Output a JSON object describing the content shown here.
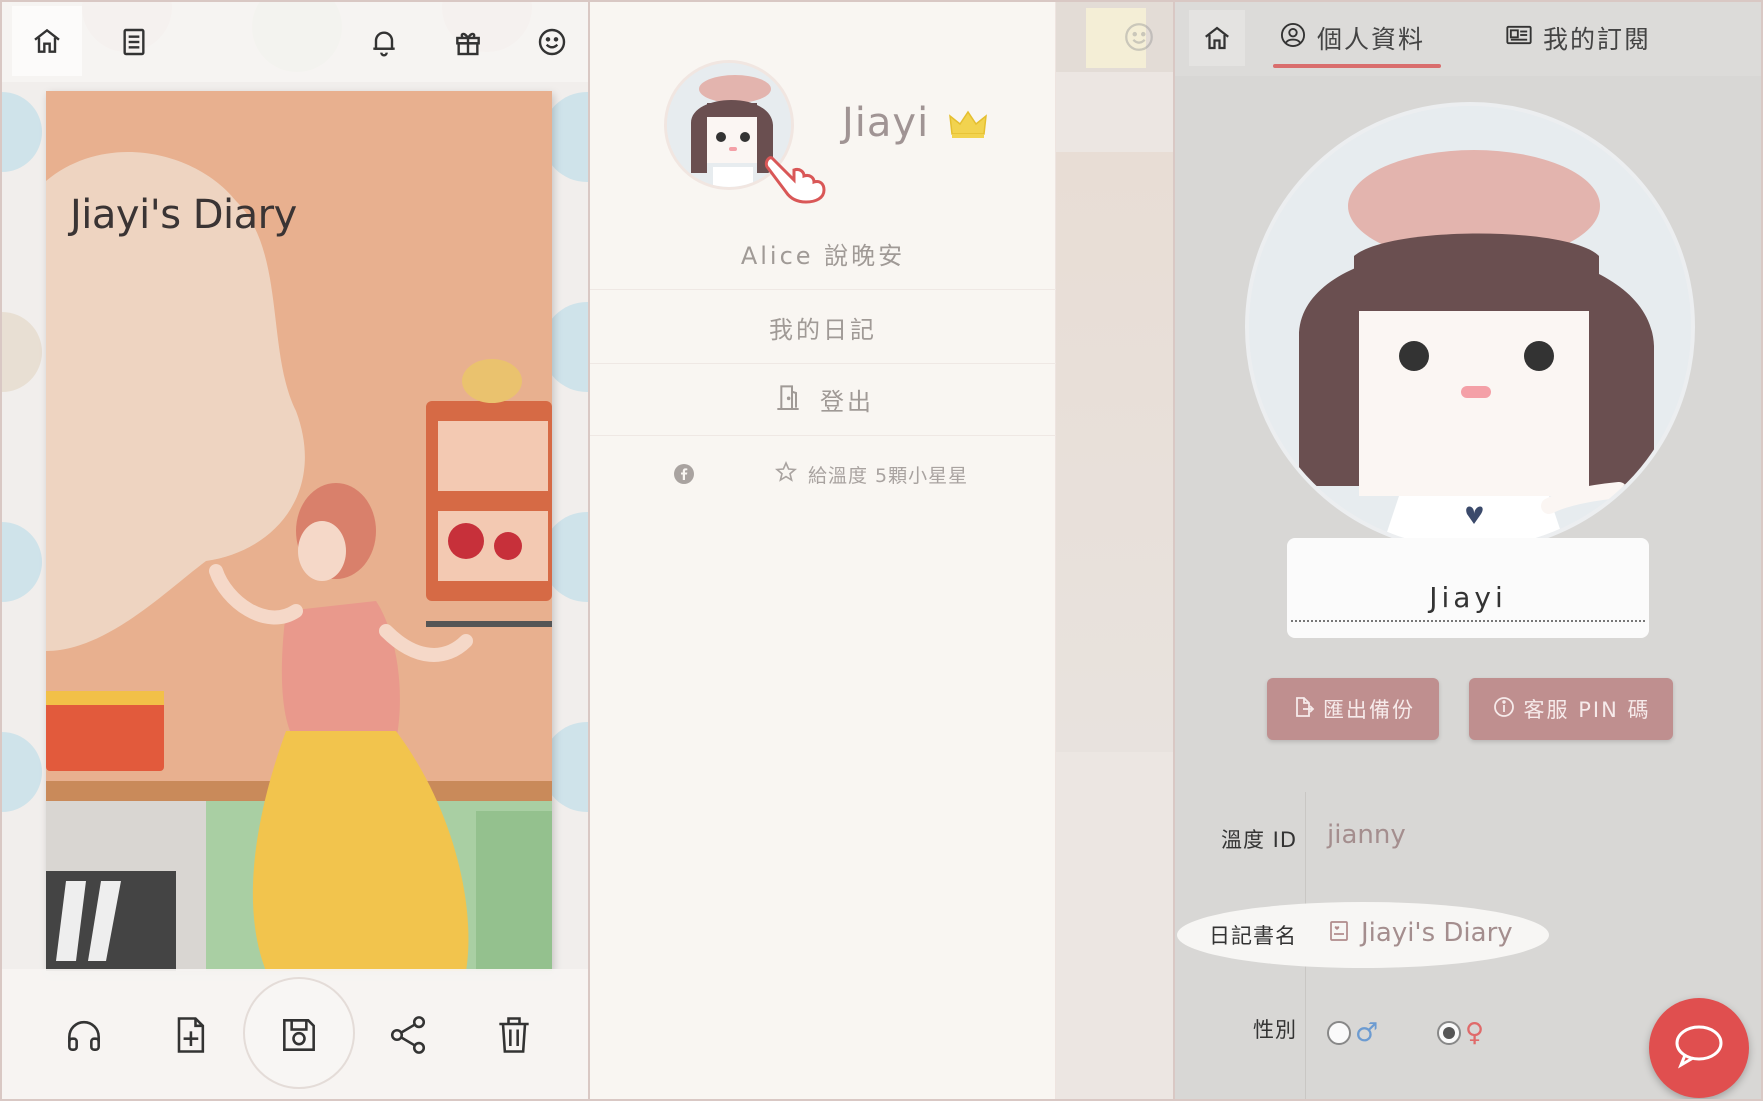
{
  "panel1": {
    "book_title": "Jiayi's Diary",
    "top_icons": [
      "home-icon",
      "notebook-icon",
      "bell-icon",
      "gift-icon",
      "smiley-icon"
    ],
    "bottom_icons": [
      "headphones-icon",
      "add-page-icon",
      "save-icon",
      "share-icon",
      "trash-icon"
    ]
  },
  "panel2": {
    "username": "Jiayi",
    "menu": {
      "greeting": "Alice 說晚安",
      "my_diary": "我的日記",
      "logout": "登出"
    },
    "rate_text": "給溫度 5顆小星星"
  },
  "panel3": {
    "tabs": [
      {
        "label": "個人資料"
      },
      {
        "label": "我的訂閱"
      }
    ],
    "name_value": "Jiayi",
    "buttons": {
      "export": "匯出備份",
      "pin": "客服 PIN 碼"
    },
    "form": {
      "id_label": "溫度 ID",
      "id_value": "jianny",
      "diary_label": "日記書名",
      "diary_value": "Jiayi's Diary",
      "gender_label": "性別",
      "gender_options": [
        {
          "symbol": "♂",
          "selected": false
        },
        {
          "symbol": "♀",
          "selected": true
        }
      ]
    }
  },
  "colors": {
    "accent_red": "#e04f4f",
    "button_rose": "#bf8f8f",
    "tab_underline": "#d96d6d",
    "crown_yellow": "#f2d34f"
  }
}
